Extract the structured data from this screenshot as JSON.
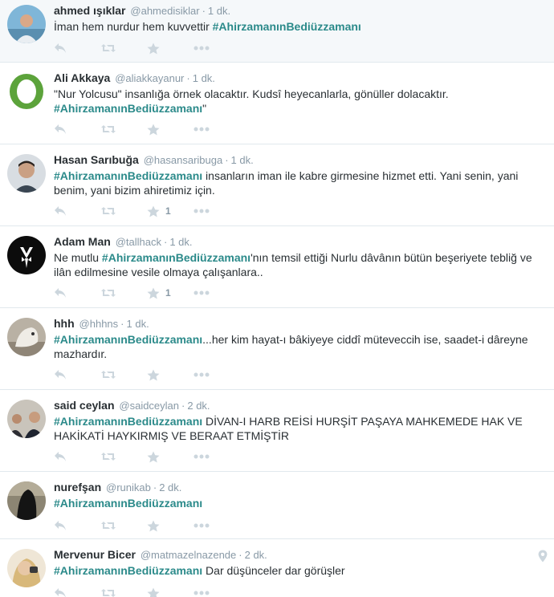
{
  "colors": {
    "hashtag": "#2b8a8a",
    "muted": "#8899a6",
    "icon": "#ccd6dd",
    "highlight_bg": "#f5f8fa",
    "border": "#e1e8ed"
  },
  "tweets": [
    {
      "fullname": "ahmed ışıklar",
      "username": "@ahmedisiklar",
      "time": "1 dk.",
      "pre": "İman hem nurdur hem kuvvettir ",
      "hashtag": "#AhirzamanınBediüzzamanı",
      "post": "",
      "favorites": ""
    },
    {
      "fullname": "Ali Akkaya",
      "username": "@aliakkayanur",
      "time": "1 dk.",
      "pre": "\"Nur Yolcusu\" insanlığa örnek olacaktır. Kudsî heyecanlarla, gönüller dolacaktır. ",
      "hashtag": "#AhirzamanınBediüzzamanı",
      "post": "\"",
      "favorites": ""
    },
    {
      "fullname": "Hasan Sarıbuğa",
      "username": "@hasansaribuga",
      "time": "1 dk.",
      "pre": "",
      "hashtag": "#AhirzamanınBediüzzamanı",
      "post": " insanların iman ile kabre girmesine hizmet etti. Yani senin, yani benim, yani bizim ahiretimiz için.",
      "favorites": "1"
    },
    {
      "fullname": "Adam Man",
      "username": "@tallhack",
      "time": "1 dk.",
      "pre": "Ne mutlu ",
      "hashtag": "#AhirzamanınBediüzzamanı",
      "post": "'nın temsil ettiği Nurlu dâvânın bütün beşeriyete tebliğ ve ilân edilmesine vesile olmaya çalışanlara..",
      "favorites": "1"
    },
    {
      "fullname": "hhh",
      "username": "@hhhns",
      "time": "1 dk.",
      "pre": "",
      "hashtag": "#AhirzamanınBediüzzamanı",
      "post": "...her kim hayat-ı bâkiyeye ciddî müteveccih ise, saadet-i dâreyne mazhardır.",
      "favorites": ""
    },
    {
      "fullname": "said ceylan",
      "username": "@saidceylan",
      "time": "2 dk.",
      "pre": "",
      "hashtag": "#AhirzamanınBediüzzamanı",
      "post": " DİVAN-I HARB REİSİ HURŞİT PAŞAYA MAHKEMEDE HAK VE HAKİKATİ HAYKIRMIŞ VE BERAAT ETMİŞTİR",
      "favorites": ""
    },
    {
      "fullname": "nurefşan",
      "username": "@runikab",
      "time": "2 dk.",
      "pre": "",
      "hashtag": "#AhirzamanınBediüzzamanı",
      "post": "",
      "favorites": ""
    },
    {
      "fullname": "Mervenur Bicer",
      "username": "@matmazelnazende",
      "time": "2 dk.",
      "pre": "",
      "hashtag": "#AhirzamanınBediüzzamanı",
      "post": " Dar düşünceler dar görüşler",
      "favorites": ""
    }
  ]
}
